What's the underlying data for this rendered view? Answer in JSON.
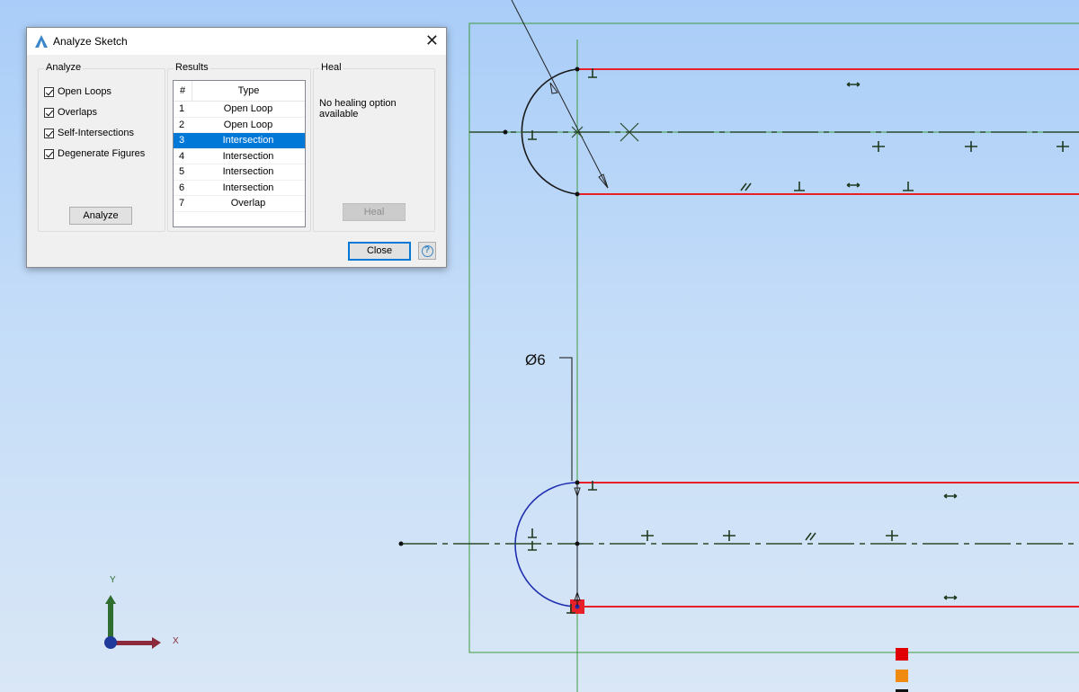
{
  "dialog": {
    "title": "Analyze Sketch",
    "analyze_group": "Analyze",
    "results_group": "Results",
    "heal_group": "Heal",
    "options": [
      {
        "label": "Open Loops",
        "checked": true
      },
      {
        "label": "Overlaps",
        "checked": true
      },
      {
        "label": "Self-Intersections",
        "checked": true
      },
      {
        "label": "Degenerate Figures",
        "checked": true
      }
    ],
    "analyze_button": "Analyze",
    "results_columns": [
      "#",
      "Type"
    ],
    "results": [
      {
        "n": "1",
        "type": "Open Loop"
      },
      {
        "n": "2",
        "type": "Open Loop"
      },
      {
        "n": "3",
        "type": "Intersection",
        "selected": true
      },
      {
        "n": "4",
        "type": "Intersection"
      },
      {
        "n": "5",
        "type": "Intersection"
      },
      {
        "n": "6",
        "type": "Intersection"
      },
      {
        "n": "7",
        "type": "Overlap"
      }
    ],
    "heal_message": "No healing option available",
    "heal_button": "Heal",
    "close_button": "Close",
    "help_icon": "question-icon"
  },
  "sketch": {
    "dimension_label": "Ø6",
    "axis_x_label": "X",
    "axis_y_label": "Y",
    "colors": {
      "open_loop": "#e8202a",
      "geometry": "#1a1a1a",
      "selected_arc": "#1f2fb0",
      "frame": "#3e9a3e",
      "constraint": "#1f3a1f",
      "status_red": "#e00000",
      "status_orange": "#f08a10"
    }
  }
}
